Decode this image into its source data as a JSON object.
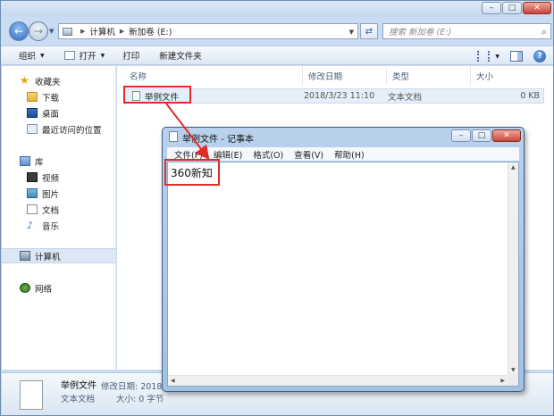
{
  "explorer": {
    "address": {
      "root": "计算机",
      "current": "新加卷 (E:)"
    },
    "search": {
      "placeholder": "搜索 新加卷 (E:)"
    },
    "toolbar": {
      "organize": "组织",
      "open": "打开",
      "print": "打印",
      "new_folder": "新建文件夹"
    },
    "nav": {
      "favorites": "收藏夹",
      "fav_items": [
        "下载",
        "桌面",
        "最近访问的位置"
      ],
      "libraries": "库",
      "lib_items": [
        "视频",
        "图片",
        "文档",
        "音乐"
      ],
      "computer": "计算机",
      "network": "网络"
    },
    "columns": {
      "name": "名称",
      "date": "修改日期",
      "type": "类型",
      "size": "大小"
    },
    "files": [
      {
        "name": "举例文件",
        "date": "2018/3/23 11:10",
        "type": "文本文档",
        "size": "0 KB"
      }
    ],
    "details": {
      "name": "举例文件",
      "date_label": "修改日期: 2018/",
      "type": "文本文档",
      "size_label": "大小: 0 字节"
    }
  },
  "notepad": {
    "title": "举例文件 - 记事本",
    "menu": [
      "文件(F)",
      "编辑(E)",
      "格式(O)",
      "查看(V)",
      "帮助(H)"
    ],
    "content": "360新知"
  },
  "colors": {
    "highlight": "#e12a2a",
    "accent": "#2f69c4"
  }
}
